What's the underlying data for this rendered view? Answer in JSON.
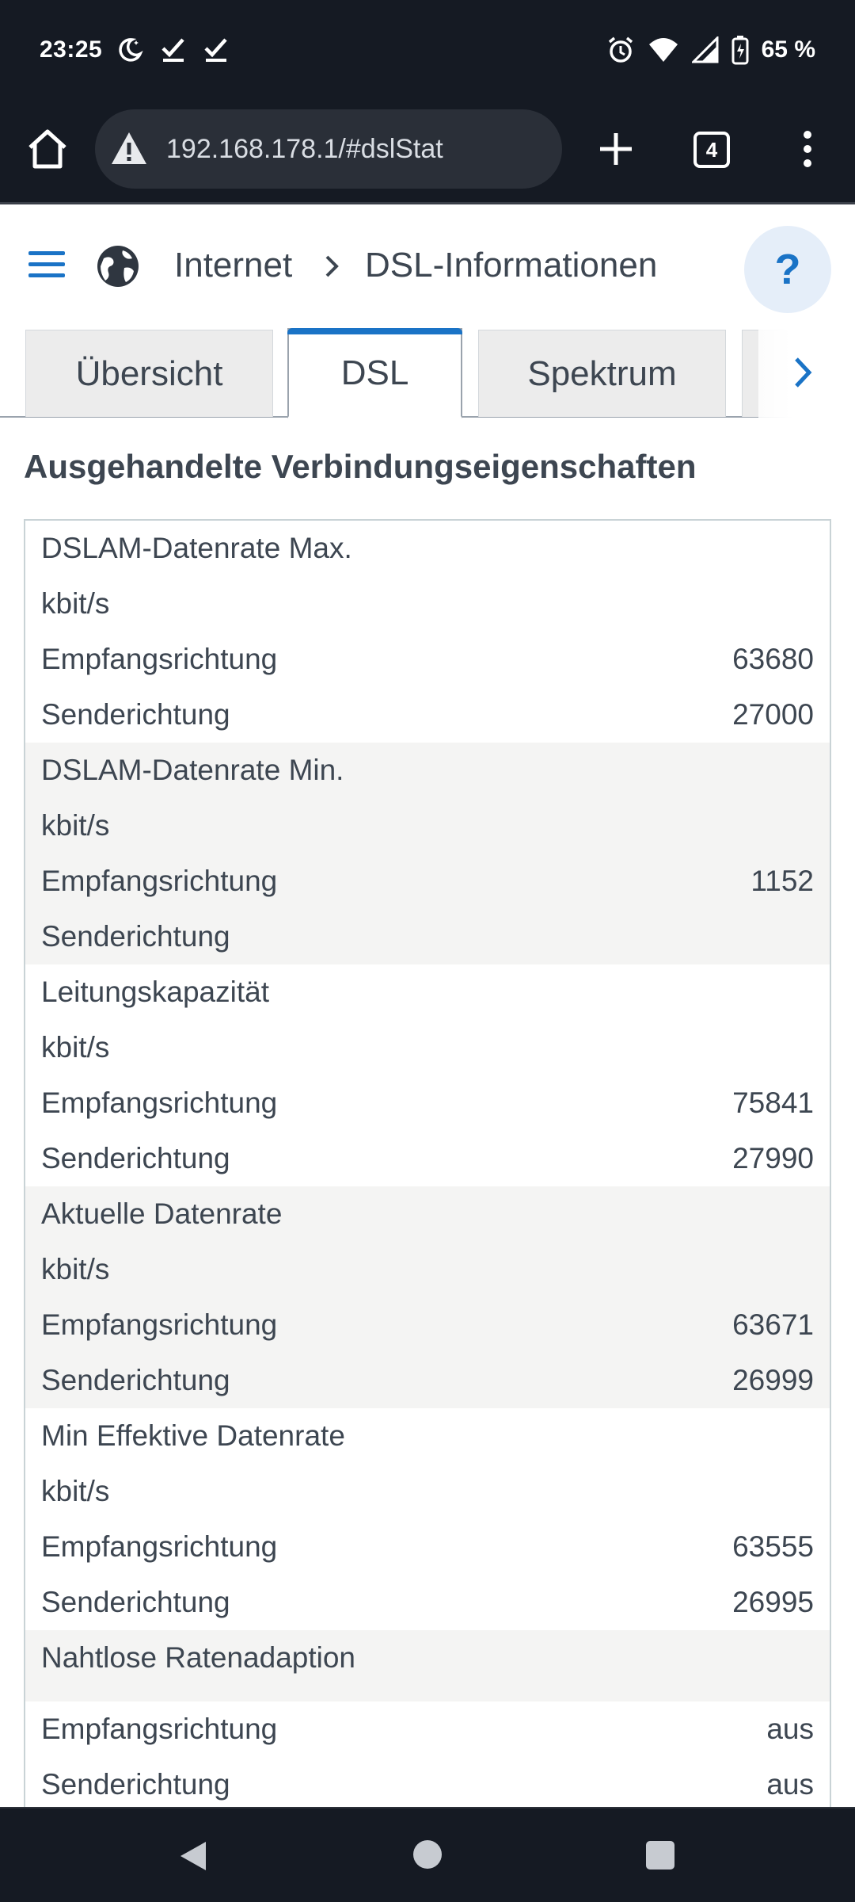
{
  "status_bar": {
    "time": "23:25",
    "battery_percent": "65 %",
    "icons_left": [
      "moon-icon",
      "check-icon",
      "check-icon"
    ],
    "icons_right": [
      "alarm-icon",
      "wifi-icon",
      "signal-icon",
      "battery-charging-icon"
    ]
  },
  "browser": {
    "url": "192.168.178.1/#dslStat",
    "tab_count": "4",
    "icons": [
      "home-icon",
      "warning-icon",
      "plus-icon",
      "more-vert-icon"
    ]
  },
  "header": {
    "breadcrumb": [
      "Internet",
      "DSL-Informationen"
    ],
    "help_label": "?"
  },
  "tabs": [
    {
      "label": "Übersicht",
      "active": false
    },
    {
      "label": "DSL",
      "active": true
    },
    {
      "label": "Spektrum",
      "active": false
    }
  ],
  "section_title": "Ausgehandelte Verbindungseigenschaften",
  "groups": [
    {
      "title": "DSLAM-Datenrate Max.",
      "unit": "kbit/s",
      "rows": [
        {
          "label": "Empfangsrichtung",
          "value": "63680"
        },
        {
          "label": "Senderichtung",
          "value": "27000"
        }
      ]
    },
    {
      "title": "DSLAM-Datenrate Min.",
      "unit": "kbit/s",
      "rows": [
        {
          "label": "Empfangsrichtung",
          "value": "1152"
        },
        {
          "label": "Senderichtung",
          "value": ""
        }
      ]
    },
    {
      "title": "Leitungskapazität",
      "unit": "kbit/s",
      "rows": [
        {
          "label": "Empfangsrichtung",
          "value": "75841"
        },
        {
          "label": "Senderichtung",
          "value": "27990"
        }
      ]
    },
    {
      "title": "Aktuelle Datenrate",
      "unit": "kbit/s",
      "rows": [
        {
          "label": "Empfangsrichtung",
          "value": "63671"
        },
        {
          "label": "Senderichtung",
          "value": "26999"
        }
      ]
    },
    {
      "title": "Min Effektive Datenrate",
      "unit": "kbit/s",
      "rows": [
        {
          "label": "Empfangsrichtung",
          "value": "63555"
        },
        {
          "label": "Senderichtung",
          "value": "26995"
        }
      ]
    },
    {
      "title": "Nahtlose Ratenadaption",
      "unit": "",
      "rows": [
        {
          "label": "Empfangsrichtung",
          "value": "aus"
        },
        {
          "label": "Senderichtung",
          "value": "aus"
        }
      ]
    }
  ],
  "colors": {
    "accent": "#1a73c6",
    "system_bar": "#151a23",
    "text": "#3d4651",
    "shaded_row": "#f4f4f3"
  }
}
